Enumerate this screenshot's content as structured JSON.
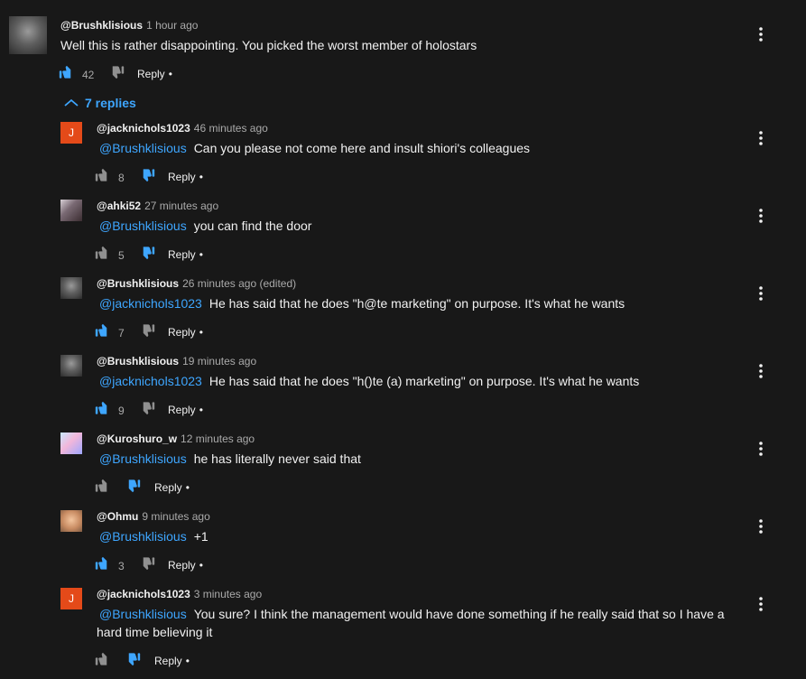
{
  "top_comment": {
    "author": "@Brushklisious",
    "time": "1 hour ago",
    "text": "Well this is rather disappointing. You picked the worst member of holostars",
    "likes": "42",
    "reply_label": "Reply",
    "dot": "•",
    "liked": true
  },
  "replies_toggle": {
    "label": "7 replies"
  },
  "replies": [
    {
      "author": "@jacknichols1023",
      "time": "46 minutes ago",
      "mention": "@Brushklisious",
      "text": "Can you please not come here and insult shiori's colleagues",
      "likes": "8",
      "reply_label": "Reply",
      "dot": "•",
      "avatar_letter": "J",
      "liked": false,
      "disliked": true
    },
    {
      "author": "@ahki52",
      "time": "27 minutes ago",
      "mention": "@Brushklisious",
      "text": "you can find the door",
      "likes": "5",
      "reply_label": "Reply",
      "dot": "•",
      "liked": false,
      "disliked": true
    },
    {
      "author": "@Brushklisious",
      "time": "26 minutes ago (edited)",
      "mention": "@jacknichols1023",
      "text": "He has said that he does \"h@te marketing\" on purpose. It's what he wants",
      "likes": "7",
      "reply_label": "Reply",
      "dot": "•",
      "liked": true,
      "disliked": false
    },
    {
      "author": "@Brushklisious",
      "time": "19 minutes ago",
      "mention": "@jacknichols1023",
      "text": "He has said that he does \"h()te (a) marketing\" on purpose. It's what he wants",
      "likes": "9",
      "reply_label": "Reply",
      "dot": "•",
      "liked": true,
      "disliked": false
    },
    {
      "author": "@Kuroshuro_w",
      "time": "12 minutes ago",
      "mention": "@Brushklisious",
      "text": "he has literally never said that",
      "likes": "",
      "reply_label": "Reply",
      "dot": "•",
      "liked": false,
      "disliked": true
    },
    {
      "author": "@Ohmu",
      "time": "9 minutes ago",
      "mention": "@Brushklisious",
      "text": "+1",
      "likes": "3",
      "reply_label": "Reply",
      "dot": "•",
      "liked": true,
      "disliked": false
    },
    {
      "author": "@jacknichols1023",
      "time": "3 minutes ago",
      "mention": "@Brushklisious",
      "text": "You sure? I think the management would have done something if he really said that so I have a hard time believing it",
      "likes": "",
      "reply_label": "Reply",
      "dot": "•",
      "avatar_letter": "J",
      "liked": false,
      "disliked": true
    }
  ],
  "colors": {
    "background": "#181818",
    "text": "#f1f1f1",
    "muted": "#aaaaaa",
    "link": "#3ea6ff",
    "active_thumb": "#3ea6ff",
    "inactive_thumb": "#909090",
    "avatar_j": "#e44a19"
  },
  "icons": {
    "like": "thumbs-up-icon",
    "dislike": "thumbs-down-icon",
    "menu": "more-vertical-icon",
    "collapse": "chevron-up-icon"
  }
}
